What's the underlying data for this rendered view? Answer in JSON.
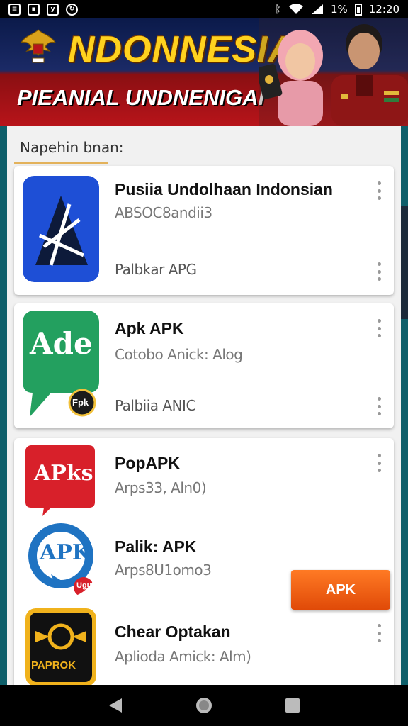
{
  "status_bar": {
    "time": "12:20",
    "battery": "1%",
    "left_icons": [
      "notification-icon",
      "image-icon",
      "app-icon",
      "sync-icon"
    ],
    "right_icons": [
      "bluetooth-icon",
      "wifi-icon",
      "signal-icon",
      "battery-icon"
    ]
  },
  "banner": {
    "title": "NDONNESIAI",
    "subtitle": "PIEANIAL UNDNENIGAI"
  },
  "section": {
    "label": "Napehin bnan:"
  },
  "apps": [
    {
      "name": "Pusiia Undolhaan Indonsian",
      "subtitle": "ABSOC8andii3",
      "meta": "Palbkar APG"
    },
    {
      "name": "Apk APK",
      "subtitle": "Cotobo Anick: Alog",
      "meta": "Palbiia ANIC",
      "icon_text": "Ade",
      "badge": "Fpk"
    },
    {
      "name": "PopAPK",
      "subtitle": "Arps33, Aln0)",
      "icon_text": "APks"
    },
    {
      "name": "Palik: APK",
      "subtitle": "Arps8U1omo3",
      "icon_text": "APK",
      "badge": "Ugu"
    },
    {
      "name": "Chear Optakan",
      "subtitle": "Aplioda Amick: Alm)",
      "icon_text": "PAPROK"
    }
  ],
  "apk_button": {
    "label": "APK"
  },
  "colors": {
    "accent_orange": "#f06a1a",
    "banner_blue": "#1b2a66",
    "banner_red": "#b8141a",
    "title_yellow": "#ffd21f"
  },
  "nav": {
    "back": "back-icon",
    "home": "home-icon",
    "recents": "recents-icon"
  }
}
